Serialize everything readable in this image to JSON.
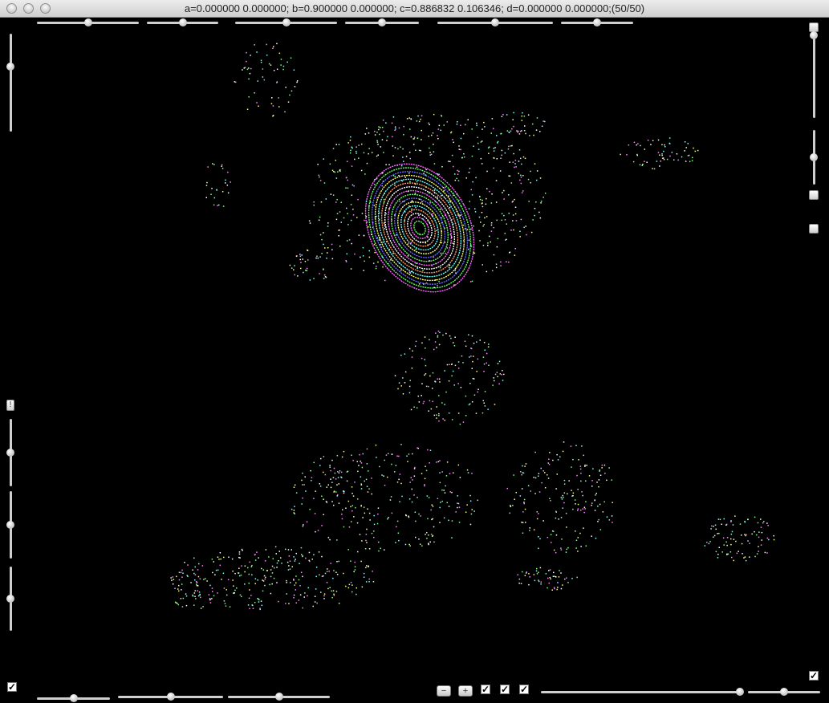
{
  "window": {
    "title": "a=0.000000 0.000000; b=0.900000 0.000000; c=0.886832 0.106346; d=0.000000 0.000000;(50/50)"
  },
  "controls": {
    "top_sliders": [
      {
        "id": "top-slider-1",
        "value": 0.5
      },
      {
        "id": "top-slider-2",
        "value": 0.5
      },
      {
        "id": "top-slider-3",
        "value": 0.5
      },
      {
        "id": "top-slider-4",
        "value": 0.5
      },
      {
        "id": "top-slider-5",
        "value": 0.5
      },
      {
        "id": "top-slider-6",
        "value": 0.5
      }
    ],
    "left_sliders": [
      {
        "id": "left-slider-1",
        "value": 0.66
      },
      {
        "id": "left-slider-2",
        "value": 0.5
      },
      {
        "id": "left-slider-3",
        "value": 0.5
      },
      {
        "id": "left-slider-4",
        "value": 0.5
      }
    ],
    "right_sliders": [
      {
        "id": "right-slider-1",
        "value": 1.0
      },
      {
        "id": "right-slider-2",
        "value": 0.5
      }
    ],
    "bottom_sliders": [
      {
        "id": "bottom-slider-1",
        "value": 0.5
      },
      {
        "id": "bottom-slider-2",
        "value": 0.5
      },
      {
        "id": "bottom-slider-3",
        "value": 0.5
      },
      {
        "id": "bottom-slider-4",
        "value": 0.99
      },
      {
        "id": "bottom-slider-5",
        "value": 0.5
      }
    ],
    "exclaim_label": "!",
    "minus_label": "−",
    "plus_label": "+",
    "check_mark": "✓",
    "checkbox_states": [
      true,
      true,
      true,
      true,
      true
    ]
  },
  "plot": {
    "background": "#000000",
    "orbit_colors": [
      "#ff66ff",
      "#66ff66",
      "#6666ff",
      "#ffff66",
      "#66ffff",
      "#ff9966",
      "#ffffff"
    ],
    "scatter_colors": [
      "#88ffff",
      "#ffffff",
      "#ff88ff",
      "#88ff88",
      "#ffff88"
    ]
  }
}
